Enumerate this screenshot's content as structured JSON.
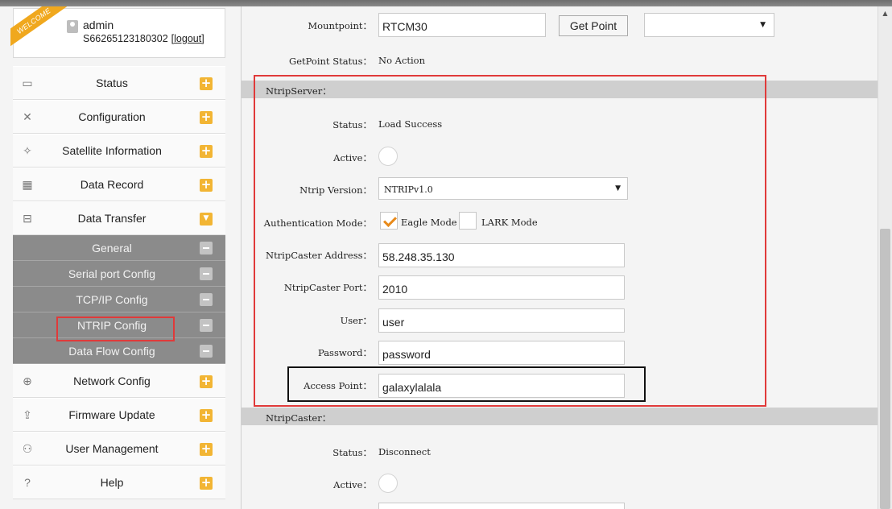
{
  "welcome": "WELCOME",
  "user": {
    "name": "admin",
    "serial": "S66265123180302",
    "logout": "[logout]"
  },
  "nav": {
    "status": {
      "label": "Status",
      "icon": "monitor-icon"
    },
    "configuration": {
      "label": "Configuration",
      "icon": "tools-icon"
    },
    "satellite": {
      "label": "Satellite Information",
      "icon": "satellite-icon"
    },
    "data_record": {
      "label": "Data Record",
      "icon": "calendar-icon"
    },
    "data_transfer": {
      "label": "Data Transfer",
      "icon": "network-icon"
    },
    "sub": {
      "general": "General",
      "serial": "Serial port Config",
      "tcpip": "TCP/IP Config",
      "ntrip": "NTRIP Config",
      "dataflow": "Data Flow Config"
    },
    "network": {
      "label": "Network Config",
      "icon": "globe-icon"
    },
    "firmware": {
      "label": "Firmware Update",
      "icon": "upload-icon"
    },
    "users": {
      "label": "User Management",
      "icon": "users-icon"
    },
    "help": {
      "label": "Help",
      "icon": "question-icon"
    }
  },
  "mount": {
    "label": "Mountpoint：",
    "value": "RTCM30",
    "get_point": "Get Point",
    "status_label": "GetPoint Status：",
    "status_value": "No Action"
  },
  "server": {
    "section": "NtripServer：",
    "status_label": "Status：",
    "status_value": "Load Success",
    "active_label": "Active：",
    "version_label": "Ntrip Version：",
    "version_value": "NTRIPv1.0",
    "auth_label": "Authentication Mode：",
    "auth_eagle": "Eagle Mode",
    "auth_lark": "LARK Mode",
    "caster_addr_label": "NtripCaster Address：",
    "caster_addr_value": "58.248.35.130",
    "caster_port_label": "NtripCaster Port：",
    "caster_port_value": "2010",
    "user_label": "User：",
    "user_value": "user",
    "password_label": "Password：",
    "password_value": "password",
    "access_label": "Access Point：",
    "access_value": "galaxylalala"
  },
  "caster": {
    "section": "NtripCaster：",
    "status_label": "Status：",
    "status_value": "Disconnect",
    "active_label": "Active："
  },
  "colors": {
    "accent": "#f2b534",
    "highlight": "#e03a3a",
    "submenu": "#8b8b8b"
  }
}
